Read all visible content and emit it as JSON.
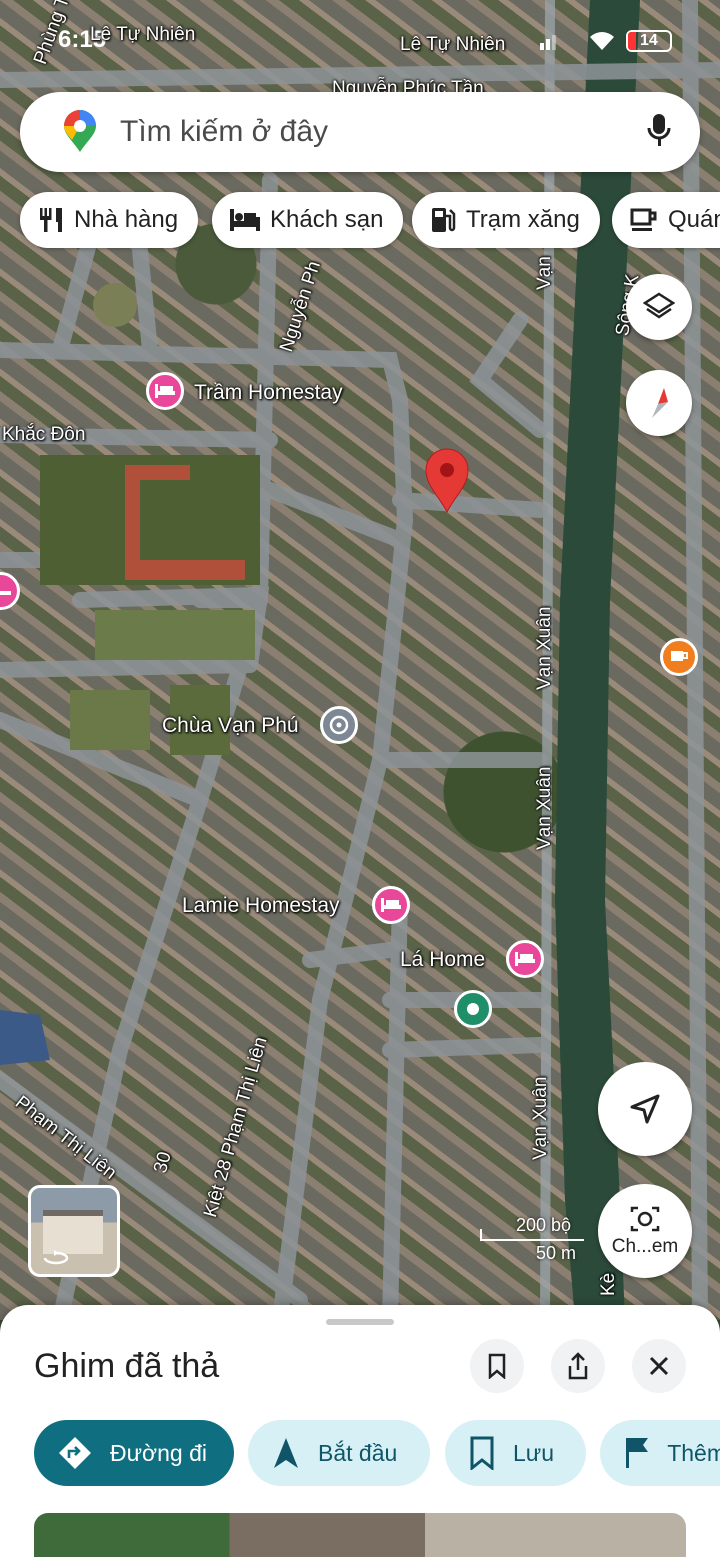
{
  "status_bar": {
    "time": "6:15",
    "battery": "14"
  },
  "search": {
    "placeholder": "Tìm kiếm ở đây"
  },
  "chips": [
    {
      "label": "Nhà hàng",
      "icon": "restaurant-icon"
    },
    {
      "label": "Khách sạn",
      "icon": "hotel-icon"
    },
    {
      "label": "Trạm xăng",
      "icon": "gas-station-icon"
    },
    {
      "label": "Quán",
      "icon": "cafe-icon"
    }
  ],
  "map_labels": {
    "le_tu_nhien_1": "Lê Tự Nhiên",
    "le_tu_nhien_2": "Lê Tự Nhiên",
    "nguyen_phuc_tan": "Nguyễn Phúc Tần",
    "nguyen_ph": "Nguyễn Ph",
    "phung_tha": "Phùng Tha",
    "van": "Vạn",
    "song": "Sông K",
    "tram_homestay": "Trầm Homestay",
    "khac_don": "Khắc Đôn",
    "chua_van_phu": "Chùa Vạn Phú",
    "van_xuan_1": "Vạn Xuân",
    "van_xuan_2": "Vạn Xuân",
    "van_xuan_3": "Vạn Xuân",
    "lamie_homestay": "Lamie Homestay",
    "la_home": "Lá Home",
    "pham_thi_lien": "Phạm Thị Liên",
    "kiet_28": "Kiệt 28 Phạm Thị Liên",
    "num_30": "30",
    "ke": "Kè"
  },
  "scale": {
    "feet": "200 bộ",
    "meters": "50 m"
  },
  "screenshot_button": {
    "label": "Ch...em"
  },
  "sheet": {
    "title": "Ghim đã thả",
    "actions": [
      {
        "label": "Đường đi",
        "icon": "directions-icon"
      },
      {
        "label": "Bắt đầu",
        "icon": "navigation-arrow-icon"
      },
      {
        "label": "Lưu",
        "icon": "bookmark-icon"
      },
      {
        "label": "Thêm",
        "icon": "flag-icon"
      }
    ]
  },
  "colors": {
    "primary": "#0f6f80",
    "secondary_bg": "#d7f0f6",
    "pin_red": "#e53935",
    "poi_pink": "#e8479a"
  }
}
